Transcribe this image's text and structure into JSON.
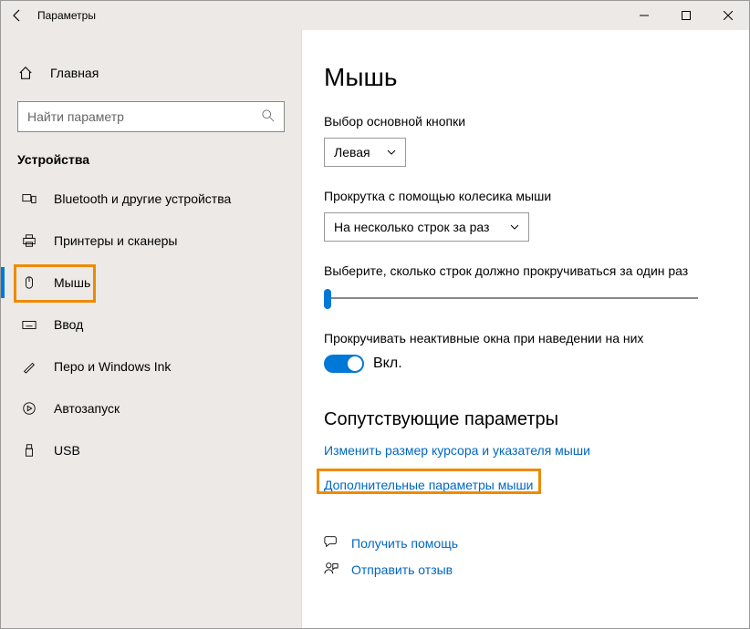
{
  "window": {
    "title": "Параметры"
  },
  "sidebar": {
    "home": "Главная",
    "search_placeholder": "Найти параметр",
    "category": "Устройства",
    "items": [
      {
        "label": "Bluetooth и другие устройства"
      },
      {
        "label": "Принтеры и сканеры"
      },
      {
        "label": "Мышь"
      },
      {
        "label": "Ввод"
      },
      {
        "label": "Перо и Windows Ink"
      },
      {
        "label": "Автозапуск"
      },
      {
        "label": "USB"
      }
    ]
  },
  "content": {
    "title": "Мышь",
    "primary_button_label": "Выбор основной кнопки",
    "primary_button_value": "Левая",
    "scroll_wheel_label": "Прокрутка с помощью колесика мыши",
    "scroll_wheel_value": "На несколько строк за раз",
    "lines_label": "Выберите, сколько строк должно прокручиваться за один раз",
    "inactive_label": "Прокручивать неактивные окна при наведении на них",
    "toggle_state": "Вкл.",
    "related_heading": "Сопутствующие параметры",
    "link_cursor": "Изменить размер курсора и указателя мыши",
    "link_advanced": "Дополнительные параметры мыши",
    "get_help": "Получить помощь",
    "feedback": "Отправить отзыв"
  }
}
